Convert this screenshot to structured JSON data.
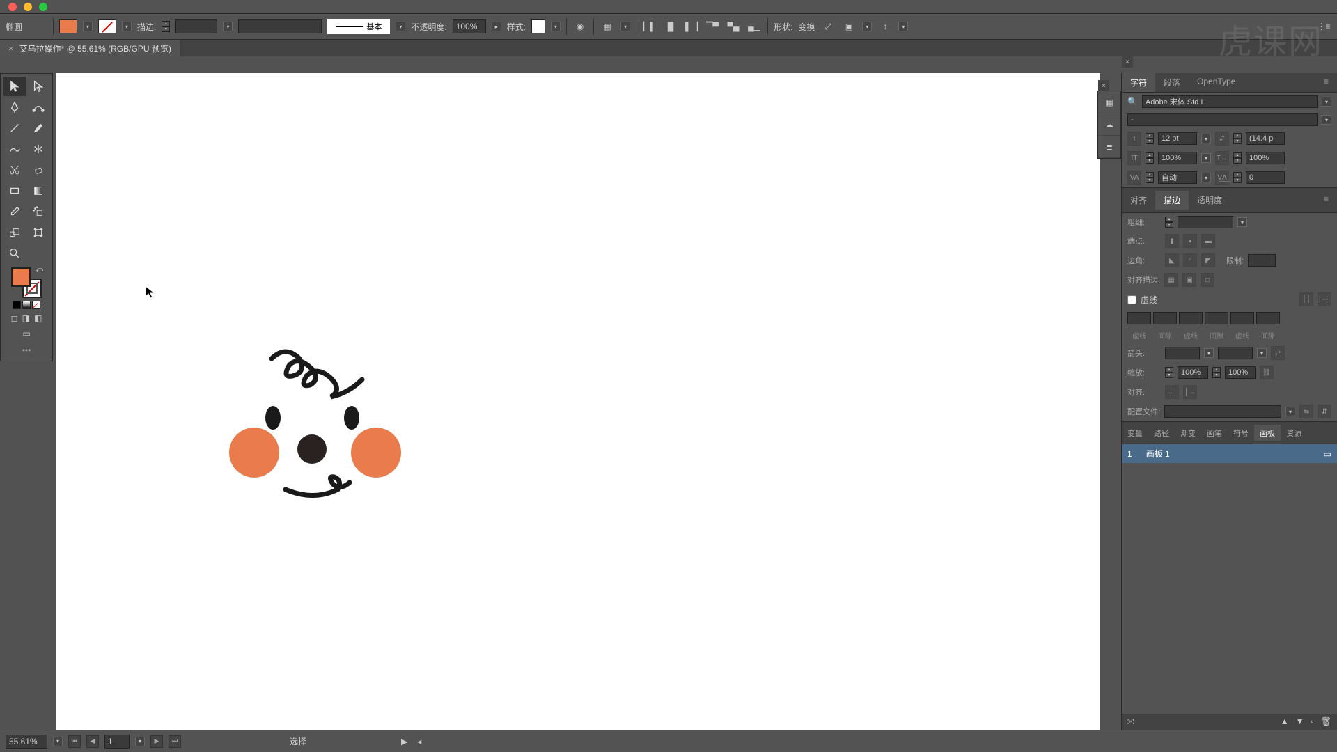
{
  "window": {
    "title": ""
  },
  "controlbar": {
    "tab_close_tooltip": "关闭"
  },
  "options": {
    "shape_name": "椭圆",
    "fill_color": "#e97b4c",
    "stroke_label": "描边:",
    "stroke_value": "",
    "stroke_style_label": "基本",
    "opacity_label": "不透明度:",
    "opacity_value": "100%",
    "style_label": "样式:",
    "shape_label": "形状:",
    "transform_label": "变换"
  },
  "doc": {
    "tab": "艾乌拉操作* @ 55.61% (RGB/GPU 预览)"
  },
  "character_panel": {
    "tabs": [
      "字符",
      "段落",
      "OpenType"
    ],
    "font_family": "Adobe 宋体 Std L",
    "font_style": "-",
    "size": "12 pt",
    "leading": "(14.4 p",
    "vscale": "100%",
    "hscale": "100%",
    "kerning": "自动",
    "tracking": "0"
  },
  "stroke_panel": {
    "tabs": [
      "对齐",
      "描边",
      "透明度"
    ],
    "weight_label": "粗细:",
    "cap_label": "端点:",
    "corner_label": "边角:",
    "limit_label": "限制:",
    "align_stroke_label": "对齐描边:",
    "dash_label": "虚线",
    "dash_cols": [
      "虚线",
      "间隙",
      "虚线",
      "间隙",
      "虚线",
      "间隙"
    ],
    "arrow_label": "箭头:",
    "scale_label": "缩放:",
    "scale_val1": "100%",
    "scale_val2": "100%",
    "align_label": "对齐:",
    "profile_label": "配置文件:"
  },
  "bottom_panel": {
    "tabs": [
      "变量",
      "路径",
      "渐变",
      "画笔",
      "符号",
      "画板",
      "资源"
    ],
    "active_tab": "画板",
    "artboards": [
      {
        "index": "1",
        "name": "画板 1"
      }
    ]
  },
  "status": {
    "zoom": "55.61%",
    "artboard": "1",
    "tool": "选择"
  },
  "watermark": "虎课网"
}
